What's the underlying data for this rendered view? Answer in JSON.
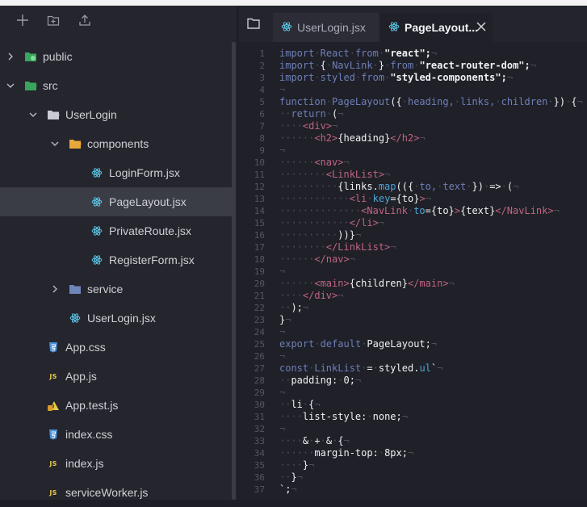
{
  "sidebar": {
    "toolbar": {
      "new_file": "plus-icon",
      "new_folder": "new-folder-icon",
      "upload": "upload-icon"
    },
    "tree": [
      {
        "label": "public",
        "depth": 0,
        "type": "folder",
        "expanded": false
      },
      {
        "label": "src",
        "depth": 0,
        "type": "folder",
        "expanded": true
      },
      {
        "label": "UserLogin",
        "depth": 1,
        "type": "folder",
        "expanded": true
      },
      {
        "label": "components",
        "depth": 2,
        "type": "folder",
        "expanded": true
      },
      {
        "label": "LoginForm.jsx",
        "depth": 3,
        "type": "react"
      },
      {
        "label": "PageLayout.jsx",
        "depth": 3,
        "type": "react",
        "selected": true
      },
      {
        "label": "PrivateRoute.jsx",
        "depth": 3,
        "type": "react"
      },
      {
        "label": "RegisterForm.jsx",
        "depth": 3,
        "type": "react"
      },
      {
        "label": "service",
        "depth": 2,
        "type": "folder",
        "expanded": false
      },
      {
        "label": "UserLogin.jsx",
        "depth": 2,
        "type": "react"
      },
      {
        "label": "App.css",
        "depth": 1,
        "type": "css"
      },
      {
        "label": "App.js",
        "depth": 1,
        "type": "js"
      },
      {
        "label": "App.test.js",
        "depth": 1,
        "type": "test"
      },
      {
        "label": "index.css",
        "depth": 1,
        "type": "css"
      },
      {
        "label": "index.js",
        "depth": 1,
        "type": "js"
      },
      {
        "label": "serviceWorker.js",
        "depth": 1,
        "type": "js"
      }
    ],
    "js_badge": "JS"
  },
  "editor": {
    "tabs": [
      {
        "label": "UserLogin.jsx",
        "active": false
      },
      {
        "label": "PageLayout...",
        "active": true
      }
    ],
    "lines": [
      [
        [
          "kw",
          "import"
        ],
        [
          "ws",
          "·"
        ],
        [
          "kw",
          "React"
        ],
        [
          "ws",
          "·"
        ],
        [
          "kw",
          "from"
        ],
        [
          "ws",
          "·"
        ],
        [
          "str",
          "\"react\";"
        ],
        [
          "ws",
          "¬"
        ]
      ],
      [
        [
          "kw",
          "import"
        ],
        [
          "ws",
          "·"
        ],
        [
          "pl",
          "{"
        ],
        [
          "ws",
          "·"
        ],
        [
          "kw",
          "NavLink"
        ],
        [
          "ws",
          "·"
        ],
        [
          "pl",
          "}"
        ],
        [
          "ws",
          "·"
        ],
        [
          "kw",
          "from"
        ],
        [
          "ws",
          "·"
        ],
        [
          "str",
          "\"react-router-dom\";"
        ],
        [
          "ws",
          "¬"
        ]
      ],
      [
        [
          "kw",
          "import"
        ],
        [
          "ws",
          "·"
        ],
        [
          "kw",
          "styled"
        ],
        [
          "ws",
          "·"
        ],
        [
          "kw",
          "from"
        ],
        [
          "ws",
          "·"
        ],
        [
          "str",
          "\"styled-components\";"
        ],
        [
          "ws",
          "¬"
        ]
      ],
      [
        [
          "ws",
          "¬"
        ]
      ],
      [
        [
          "kw",
          "function"
        ],
        [
          "ws",
          "·"
        ],
        [
          "kw",
          "PageLayout"
        ],
        [
          "pl",
          "({"
        ],
        [
          "ws",
          "·"
        ],
        [
          "kw",
          "heading,"
        ],
        [
          "ws",
          "·"
        ],
        [
          "kw",
          "links,"
        ],
        [
          "ws",
          "·"
        ],
        [
          "kw",
          "children"
        ],
        [
          "ws",
          "·"
        ],
        [
          "pl",
          "})"
        ],
        [
          "ws",
          "·"
        ],
        [
          "pl",
          "{"
        ],
        [
          "ws",
          "¬"
        ]
      ],
      [
        [
          "ws",
          "··"
        ],
        [
          "kw",
          "return"
        ],
        [
          "ws",
          "·"
        ],
        [
          "pl",
          "("
        ],
        [
          "ws",
          "¬"
        ]
      ],
      [
        [
          "ws",
          "····"
        ],
        [
          "tag",
          "<div>"
        ],
        [
          "ws",
          "¬"
        ]
      ],
      [
        [
          "ws",
          "······"
        ],
        [
          "tag",
          "<h2>"
        ],
        [
          "pl",
          "{heading}"
        ],
        [
          "tag",
          "</h2>"
        ],
        [
          "ws",
          "¬"
        ]
      ],
      [
        [
          "ws",
          "¬"
        ]
      ],
      [
        [
          "ws",
          "······"
        ],
        [
          "tag",
          "<nav>"
        ],
        [
          "ws",
          "¬"
        ]
      ],
      [
        [
          "ws",
          "········"
        ],
        [
          "tag",
          "<LinkList>"
        ],
        [
          "ws",
          "¬"
        ]
      ],
      [
        [
          "ws",
          "··········"
        ],
        [
          "pl",
          "{links."
        ],
        [
          "attr",
          "map"
        ],
        [
          "pl",
          "(({"
        ],
        [
          "ws",
          "·"
        ],
        [
          "kw",
          "to,"
        ],
        [
          "ws",
          "·"
        ],
        [
          "kw",
          "text"
        ],
        [
          "ws",
          "·"
        ],
        [
          "pl",
          "})"
        ],
        [
          "ws",
          "·"
        ],
        [
          "pl",
          "=>"
        ],
        [
          "ws",
          "·"
        ],
        [
          "pl",
          "("
        ],
        [
          "ws",
          "¬"
        ]
      ],
      [
        [
          "ws",
          "············"
        ],
        [
          "tag",
          "<li"
        ],
        [
          "ws",
          "·"
        ],
        [
          "attr",
          "key"
        ],
        [
          "pl",
          "={to}"
        ],
        [
          "tag",
          ">"
        ],
        [
          "ws",
          "¬"
        ]
      ],
      [
        [
          "ws",
          "··············"
        ],
        [
          "tag",
          "<NavLink"
        ],
        [
          "ws",
          "·"
        ],
        [
          "attr",
          "to"
        ],
        [
          "pl",
          "={to}"
        ],
        [
          "tag",
          ">"
        ],
        [
          "pl",
          "{text}"
        ],
        [
          "tag",
          "</NavLink>"
        ],
        [
          "ws",
          "¬"
        ]
      ],
      [
        [
          "ws",
          "············"
        ],
        [
          "tag",
          "</li>"
        ],
        [
          "ws",
          "¬"
        ]
      ],
      [
        [
          "ws",
          "··········"
        ],
        [
          "pl",
          "))}"
        ],
        [
          "ws",
          "¬"
        ]
      ],
      [
        [
          "ws",
          "········"
        ],
        [
          "tag",
          "</LinkList>"
        ],
        [
          "ws",
          "¬"
        ]
      ],
      [
        [
          "ws",
          "······"
        ],
        [
          "tag",
          "</nav>"
        ],
        [
          "ws",
          "¬"
        ]
      ],
      [
        [
          "ws",
          "¬"
        ]
      ],
      [
        [
          "ws",
          "······"
        ],
        [
          "tag",
          "<main>"
        ],
        [
          "pl",
          "{children}"
        ],
        [
          "tag",
          "</main>"
        ],
        [
          "ws",
          "¬"
        ]
      ],
      [
        [
          "ws",
          "····"
        ],
        [
          "tag",
          "</div>"
        ],
        [
          "ws",
          "¬"
        ]
      ],
      [
        [
          "ws",
          "··"
        ],
        [
          "pl",
          ");"
        ],
        [
          "ws",
          "¬"
        ]
      ],
      [
        [
          "pl",
          "}"
        ],
        [
          "ws",
          "¬"
        ]
      ],
      [
        [
          "ws",
          "¬"
        ]
      ],
      [
        [
          "kw",
          "export"
        ],
        [
          "ws",
          "·"
        ],
        [
          "kw",
          "default"
        ],
        [
          "ws",
          "·"
        ],
        [
          "pl",
          "PageLayout;"
        ],
        [
          "ws",
          "¬"
        ]
      ],
      [
        [
          "ws",
          "¬"
        ]
      ],
      [
        [
          "kw",
          "const"
        ],
        [
          "ws",
          "·"
        ],
        [
          "kw",
          "LinkList"
        ],
        [
          "ws",
          "·"
        ],
        [
          "pl",
          "="
        ],
        [
          "ws",
          "·"
        ],
        [
          "pl",
          "styled."
        ],
        [
          "attr",
          "ul"
        ],
        [
          "pl",
          "`"
        ],
        [
          "ws",
          "¬"
        ]
      ],
      [
        [
          "ws",
          "··"
        ],
        [
          "pl",
          "padding:"
        ],
        [
          "ws",
          "·"
        ],
        [
          "pl",
          "0;"
        ],
        [
          "ws",
          "¬"
        ]
      ],
      [
        [
          "ws",
          "¬"
        ]
      ],
      [
        [
          "ws",
          "··"
        ],
        [
          "pl",
          "li"
        ],
        [
          "ws",
          "·"
        ],
        [
          "pl",
          "{"
        ],
        [
          "ws",
          "¬"
        ]
      ],
      [
        [
          "ws",
          "····"
        ],
        [
          "pl",
          "list-style:"
        ],
        [
          "ws",
          "·"
        ],
        [
          "pl",
          "none;"
        ],
        [
          "ws",
          "¬"
        ]
      ],
      [
        [
          "ws",
          "¬"
        ]
      ],
      [
        [
          "ws",
          "····"
        ],
        [
          "pl",
          "&"
        ],
        [
          "ws",
          "·"
        ],
        [
          "pl",
          "+"
        ],
        [
          "ws",
          "·"
        ],
        [
          "pl",
          "&"
        ],
        [
          "ws",
          "·"
        ],
        [
          "pl",
          "{"
        ],
        [
          "ws",
          "¬"
        ]
      ],
      [
        [
          "ws",
          "······"
        ],
        [
          "pl",
          "margin-top:"
        ],
        [
          "ws",
          "·"
        ],
        [
          "pl",
          "8px;"
        ],
        [
          "ws",
          "¬"
        ]
      ],
      [
        [
          "ws",
          "····"
        ],
        [
          "pl",
          "}"
        ],
        [
          "ws",
          "¬"
        ]
      ],
      [
        [
          "ws",
          "··"
        ],
        [
          "pl",
          "}"
        ],
        [
          "ws",
          "¬"
        ]
      ],
      [
        [
          "pl",
          "`;"
        ],
        [
          "ws",
          "¬"
        ]
      ]
    ]
  },
  "colors": {
    "sidebar_bg": "#24252d",
    "editor_bg": "#1f2028",
    "selected_row": "#3a3c46",
    "react_icon": "#5cc8e8",
    "folder_open": "#e8a83a",
    "css_icon": "#4a8fd6",
    "js_badge": "#e6c84a"
  }
}
